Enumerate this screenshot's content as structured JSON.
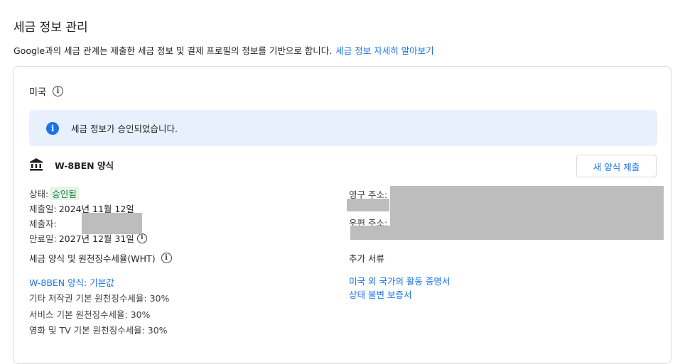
{
  "page": {
    "title": "세금 정보 관리",
    "intro_text": "Google과의 세금 관계는 제출한 세금 정보 및 결제 프로필의 정보를 기반으로 합니다.",
    "intro_link": "세금 정보 자세히 알아보기"
  },
  "card": {
    "country": "미국",
    "banner_text": "세금 정보가 승인되었습니다.",
    "form_name": "W-8BEN 양식",
    "new_form_button": "새 양식 제출",
    "status_label": "상태:",
    "status_value": "승인됨",
    "submitted_label": "제출일:",
    "submitted_value": "2024년 11월 12일",
    "submitter_label": "제출자:",
    "expiry_label": "만료일:",
    "expiry_value": "2027년 12월 31일",
    "permanent_address_label": "영구 주소:",
    "mailing_address_label": "우편 주소:",
    "wht_title": "세금 양식 및 원천징수세율(WHT)",
    "wht_items": [
      "W-8BEN 양식: 기본값",
      "기타 저작권 기본 원천징수세율: 30%",
      "서비스 기본 원천징수세율: 30%",
      "영화 및 TV 기본 원천징수세율: 30%"
    ],
    "docs_title": "추가 서류",
    "docs_items": [
      "미국 외 국가의 활동 증명서",
      "상태 불변 보증서"
    ]
  },
  "colors": {
    "accent": "#1a73e8",
    "banner_bg": "#e8f0fe",
    "approved_bg": "#e6f4ea",
    "approved_text": "#188038",
    "redaction": "#bdbdbd"
  }
}
